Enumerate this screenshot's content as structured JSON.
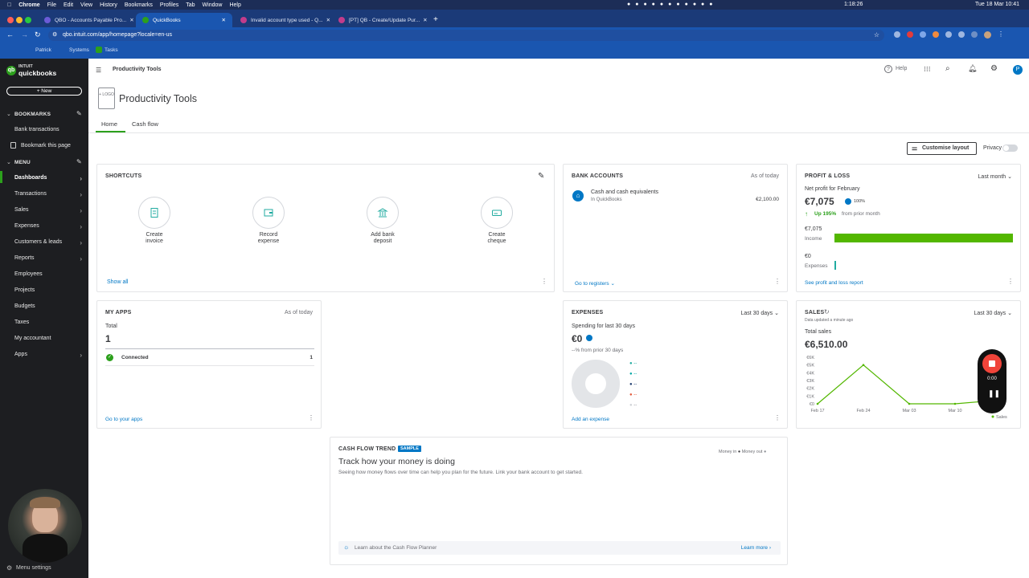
{
  "mac_menu": {
    "app": "Chrome",
    "items": [
      "File",
      "Edit",
      "View",
      "History",
      "Bookmarks",
      "Profiles",
      "Tab",
      "Window",
      "Help"
    ],
    "timer": "1:18:26",
    "datetime": "Tue 18 Mar  10:41"
  },
  "browser": {
    "tabs": [
      {
        "label": "QBO - Accounts Payable Pro..."
      },
      {
        "label": "QuickBooks"
      },
      {
        "label": "Invalid account type used - Q..."
      },
      {
        "label": "[PT] QB - Create/Update Pur..."
      }
    ],
    "url": "qbo.intuit.com/app/homepage?locale=en-us",
    "bookmarks": [
      "Patrick",
      "Systems",
      "Tasks"
    ]
  },
  "sidebar": {
    "logo_top": "INTUIT",
    "logo_bottom": "quickbooks",
    "new_button": "+ New",
    "bookmarks_heading": "BOOKMARKS",
    "bookmark_items": [
      "Bank transactions",
      "Bookmark this page"
    ],
    "menu_heading": "MENU",
    "menu_items": [
      {
        "label": "Dashboards",
        "chevron": true
      },
      {
        "label": "Transactions",
        "chevron": true
      },
      {
        "label": "Sales",
        "chevron": true
      },
      {
        "label": "Expenses",
        "chevron": true
      },
      {
        "label": "Customers & leads",
        "chevron": true
      },
      {
        "label": "Reports",
        "chevron": true
      },
      {
        "label": "Employees",
        "chevron": false
      },
      {
        "label": "Projects",
        "chevron": false
      },
      {
        "label": "Budgets",
        "chevron": false
      },
      {
        "label": "Taxes",
        "chevron": false
      },
      {
        "label": "My accountant",
        "chevron": false
      },
      {
        "label": "Apps",
        "chevron": true
      }
    ],
    "menu_settings": "Menu settings"
  },
  "topbar": {
    "company": "Productivity Tools",
    "help": "Help",
    "avatar": "P"
  },
  "page": {
    "logo_placeholder": "+ LOGO",
    "company_name": "Productivity Tools",
    "tabs": [
      "Home",
      "Cash flow"
    ],
    "customise_button": "Customise layout",
    "privacy_label": "Privacy"
  },
  "shortcuts": {
    "title": "SHORTCUTS",
    "items": [
      {
        "line1": "Create",
        "line2": "invoice"
      },
      {
        "line1": "Record",
        "line2": "expense"
      },
      {
        "line1": "Add bank",
        "line2": "deposit"
      },
      {
        "line1": "Create",
        "line2": "cheque"
      }
    ],
    "show_all": "Show all"
  },
  "bank_accounts": {
    "title": "BANK ACCOUNTS",
    "as_of": "As of today",
    "account_name": "Cash and cash equivalents",
    "account_sub": "In QuickBooks",
    "amount": "€2,100.00",
    "footer_link": "Go to registers"
  },
  "profit_loss": {
    "title": "PROFIT & LOSS",
    "period": "Last month",
    "net_label": "Net profit for February",
    "net_value": "€7,075",
    "pct_badge": "100%",
    "change": "Up 195%",
    "change_suffix": "from prior month",
    "income_value": "€7,075",
    "income_label": "Income",
    "income_fraction": 1.0,
    "expenses_value": "€0",
    "expenses_label": "Expenses",
    "expenses_fraction": 0,
    "footer_link": "See profit and loss report",
    "colors": {
      "income": "#53b700",
      "expenses": "#21aba0"
    }
  },
  "my_apps": {
    "title": "MY APPS",
    "as_of": "As of today",
    "total_label": "Total",
    "total_value": "1",
    "connected_label": "Connected",
    "connected_value": "1",
    "footer_link": "Go to your apps"
  },
  "expenses": {
    "title": "EXPENSES",
    "period": "Last 30 days",
    "spending_label": "Spending for last 30 days",
    "value": "€0",
    "change": "--% from prior 30 days",
    "legend": [
      {
        "label": "--",
        "color": "#21aba0"
      },
      {
        "label": "--",
        "color": "#00a6a4"
      },
      {
        "label": "--",
        "color": "#1d3c6e"
      },
      {
        "label": "--",
        "color": "#e2593b"
      },
      {
        "label": "--",
        "color": "#cfd2d6"
      }
    ],
    "footer_link": "Add an expense"
  },
  "sales": {
    "title": "SALES",
    "updated": "Data updated a minute ago",
    "period": "Last 30 days",
    "total_label": "Total sales",
    "total_value": "€6,510.00",
    "legend_label": "Sales",
    "chart_data": {
      "type": "line",
      "x": [
        "Feb 17",
        "Feb 24",
        "Mar 03",
        "Mar 10",
        "Mar 17"
      ],
      "series": [
        {
          "name": "Sales",
          "values": [
            0,
            5000,
            0,
            0,
            500
          ]
        }
      ],
      "y_ticks": [
        "€6K",
        "€5K",
        "€4K",
        "€3K",
        "€2K",
        "€1K",
        "€0"
      ],
      "ylim": [
        0,
        6000
      ],
      "x_ticks": [
        "Feb 17",
        "Feb 24",
        "Mar 03",
        "Mar 10"
      ],
      "color": "#53b700"
    }
  },
  "cash_flow": {
    "title": "CASH FLOW TREND",
    "badge": "SAMPLE",
    "legend_in": "Money in",
    "legend_out": "Money out",
    "heading": "Track how your money is doing",
    "description": "Seeing how money flows over time can help you plan for the future. Link your bank account to get started.",
    "footer_text": "Learn about the Cash Flow Planner",
    "footer_link": "Learn more"
  },
  "recorder": {
    "time": "0:00"
  }
}
